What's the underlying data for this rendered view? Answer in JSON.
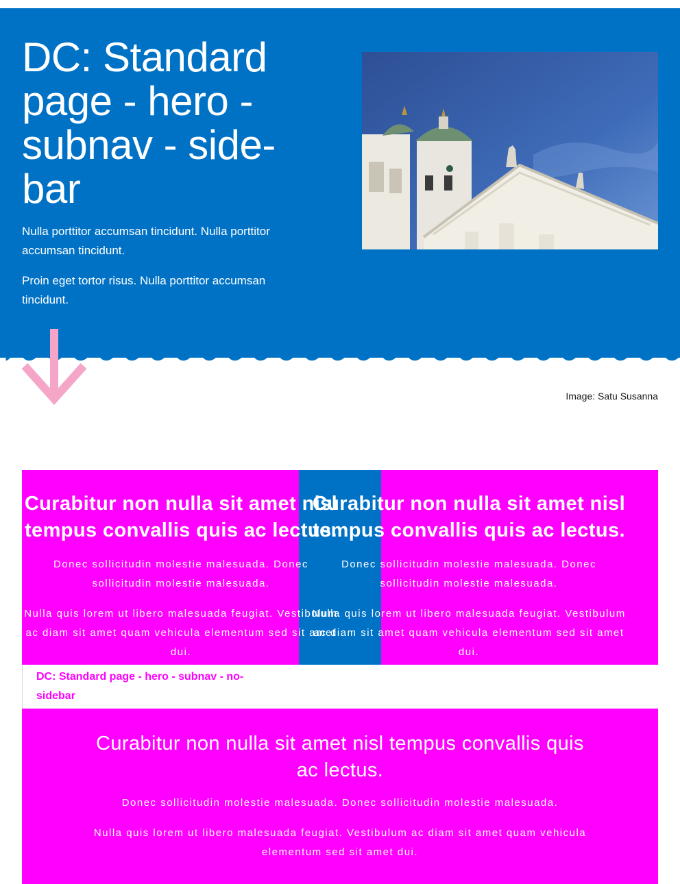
{
  "hero": {
    "title": "DC: Standard page - hero - subnav - side-bar",
    "paragraphs": [
      "Nulla porttitor accumsan tincidunt. Nulla porttitor accumsan tincidunt.",
      "Proin eget tortor risus. Nulla porttitor accumsan tincidunt."
    ],
    "image_caption": "Image: Satu Susanna",
    "colors": {
      "background": "#0072c6",
      "text": "#ffffff",
      "arrow": "#f4a5c8"
    }
  },
  "content_row": {
    "cards": [
      {
        "heading": "Curabitur non nulla sit amet nisl tempus convallis quis ac lectus.",
        "paragraphs": [
          "Donec sollicitudin molestie malesuada. Donec sollicitudin molestie malesuada.",
          "Nulla quis lorem ut libero malesuada feugiat. Vestibulum ac diam sit amet quam vehicula elementum sed sit amet dui."
        ]
      },
      {
        "heading": "Curabitur non nulla sit amet nisl tempus convallis quis ac lectus.",
        "paragraphs": [
          "Donec sollicitudin molestie malesuada. Donec sollicitudin molestie malesuada.",
          "Nulla quis lorem ut libero malesuada feugiat. Vestibulum ac diam sit amet quam vehicula elementum sed sit amet dui."
        ]
      }
    ],
    "overflow_fragments": {
      "heading": "et nisl Curab",
      "heading2": "ctus. tempu",
      "p1": "sollicitudinec soll",
      "p2a": "Vestibul Nulla quis",
      "p2b": "ametulum sit am"
    },
    "colors": {
      "card": "#ff00ff",
      "strip": "#0072c6",
      "text": "#ffffff"
    }
  },
  "subnav": {
    "link_label": "DC: Standard page - hero - subnav - no-sidebar",
    "color": "#ff00ff"
  },
  "band": {
    "heading": "Curabitur non nulla sit amet nisl tempus convallis quis ac lectus.",
    "paragraphs": [
      "Donec sollicitudin molestie malesuada. Donec sollicitudin molestie malesuada.",
      "Nulla quis lorem ut libero malesuada feugiat. Vestibulum ac diam sit amet quam vehicula elementum sed sit amet dui."
    ]
  }
}
